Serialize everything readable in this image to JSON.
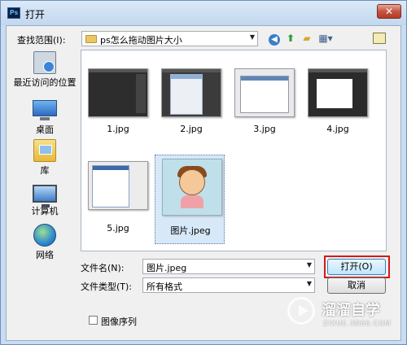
{
  "window": {
    "app_icon": "Ps",
    "title": "打开",
    "close_glyph": "✕"
  },
  "navigation": {
    "lookin_label": "查找范围(I):",
    "lookin_value": "ps怎么拖动图片大小",
    "toolbar": {
      "back_icon": "back-icon",
      "up_icon": "up-folder-icon",
      "new_folder_icon": "new-folder-icon",
      "view_icon": "view-menu-icon",
      "desktop_icon": "desktop-icon"
    }
  },
  "places": [
    {
      "label": "最近访问的位置",
      "icon": "recent-places-icon"
    },
    {
      "label": "桌面",
      "icon": "desktop-icon"
    },
    {
      "label": "库",
      "icon": "library-icon"
    },
    {
      "label": "计算机",
      "icon": "computer-icon"
    },
    {
      "label": "网络",
      "icon": "network-icon"
    }
  ],
  "files": [
    {
      "name": "1.jpg",
      "selected": false
    },
    {
      "name": "2.jpg",
      "selected": false
    },
    {
      "name": "3.jpg",
      "selected": false
    },
    {
      "name": "4.jpg",
      "selected": false
    },
    {
      "name": "5.jpg",
      "selected": false
    },
    {
      "name": "图片.jpeg",
      "selected": true
    }
  ],
  "form": {
    "filename_label": "文件名(N):",
    "filename_value": "图片.jpeg",
    "filetype_label": "文件类型(T):",
    "filetype_value": "所有格式",
    "open_label": "打开(O)",
    "cancel_label": "取消",
    "sequence_label": "图像序列"
  },
  "watermark": {
    "name": "溜溜自学",
    "url": "ZIXUE.3D66.COM"
  },
  "colors": {
    "highlight": "#d01a1a",
    "selection": "#d7e8f8"
  }
}
